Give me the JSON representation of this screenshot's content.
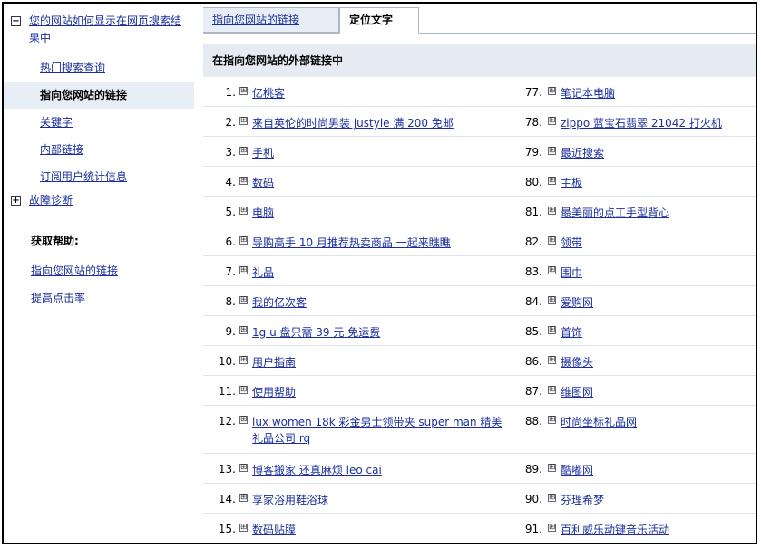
{
  "sidebar": {
    "section1_title": "您的网站如何显示在网页搜索结果中",
    "section1_toggle": "−",
    "items": [
      {
        "label": "热门搜索查询",
        "active": false
      },
      {
        "label": "指向您网站的链接",
        "active": true
      },
      {
        "label": "关键字",
        "active": false
      },
      {
        "label": "内部链接",
        "active": false
      },
      {
        "label": "订阅用户统计信息",
        "active": false
      }
    ],
    "section2_title": "故障诊断",
    "section2_toggle": "+",
    "help_title": "获取帮助:",
    "help_links": [
      "指向您网站的链接",
      "提高点击率"
    ]
  },
  "tabs": [
    {
      "label": "指向您网站的链接",
      "active": false
    },
    {
      "label": "定位文字",
      "active": true
    }
  ],
  "panel": {
    "title": "在指向您网站的外部链接中",
    "plus_glyph": "⊞"
  },
  "list_left": [
    {
      "num": "1.",
      "text": "亿桃客"
    },
    {
      "num": "2.",
      "text": "来自英伦的时尚男装 justyle 满 200 免邮"
    },
    {
      "num": "3.",
      "text": "手机"
    },
    {
      "num": "4.",
      "text": "数码"
    },
    {
      "num": "5.",
      "text": "电脑"
    },
    {
      "num": "6.",
      "text": "导购高手 10 月推荐热卖商品 一起来瞧瞧"
    },
    {
      "num": "7.",
      "text": "礼品"
    },
    {
      "num": "8.",
      "text": "我的亿次客"
    },
    {
      "num": "9.",
      "text": "1g u 盘只需 39 元 免运费"
    },
    {
      "num": "10.",
      "text": "用户指南"
    },
    {
      "num": "11.",
      "text": "使用帮助"
    },
    {
      "num": "12.",
      "text": "lux women 18k 彩金男士领带夹 super man 精美礼品公司 rq"
    },
    {
      "num": "13.",
      "text": "博客搬家 还真麻烦 leo cai"
    },
    {
      "num": "14.",
      "text": "享家浴用鞋浴球"
    },
    {
      "num": "15.",
      "text": "数码贴膜"
    }
  ],
  "list_right": [
    {
      "num": "77.",
      "text": "笔记本电脑"
    },
    {
      "num": "78.",
      "text": "zippo 蓝宝石翡翠 21042 打火机"
    },
    {
      "num": "79.",
      "text": "最近搜索"
    },
    {
      "num": "80.",
      "text": "主板"
    },
    {
      "num": "81.",
      "text": "最美丽的点工手型背心"
    },
    {
      "num": "82.",
      "text": "领带"
    },
    {
      "num": "83.",
      "text": "围巾"
    },
    {
      "num": "84.",
      "text": "爱购网"
    },
    {
      "num": "85.",
      "text": "首饰"
    },
    {
      "num": "86.",
      "text": "摄像头"
    },
    {
      "num": "87.",
      "text": "维图网"
    },
    {
      "num": "88.",
      "text": "时尚坐标礼品网"
    },
    {
      "num": "89.",
      "text": "酷嘟网"
    },
    {
      "num": "90.",
      "text": "芬理希梦"
    },
    {
      "num": "91.",
      "text": "百利威乐动键音乐活动"
    }
  ]
}
